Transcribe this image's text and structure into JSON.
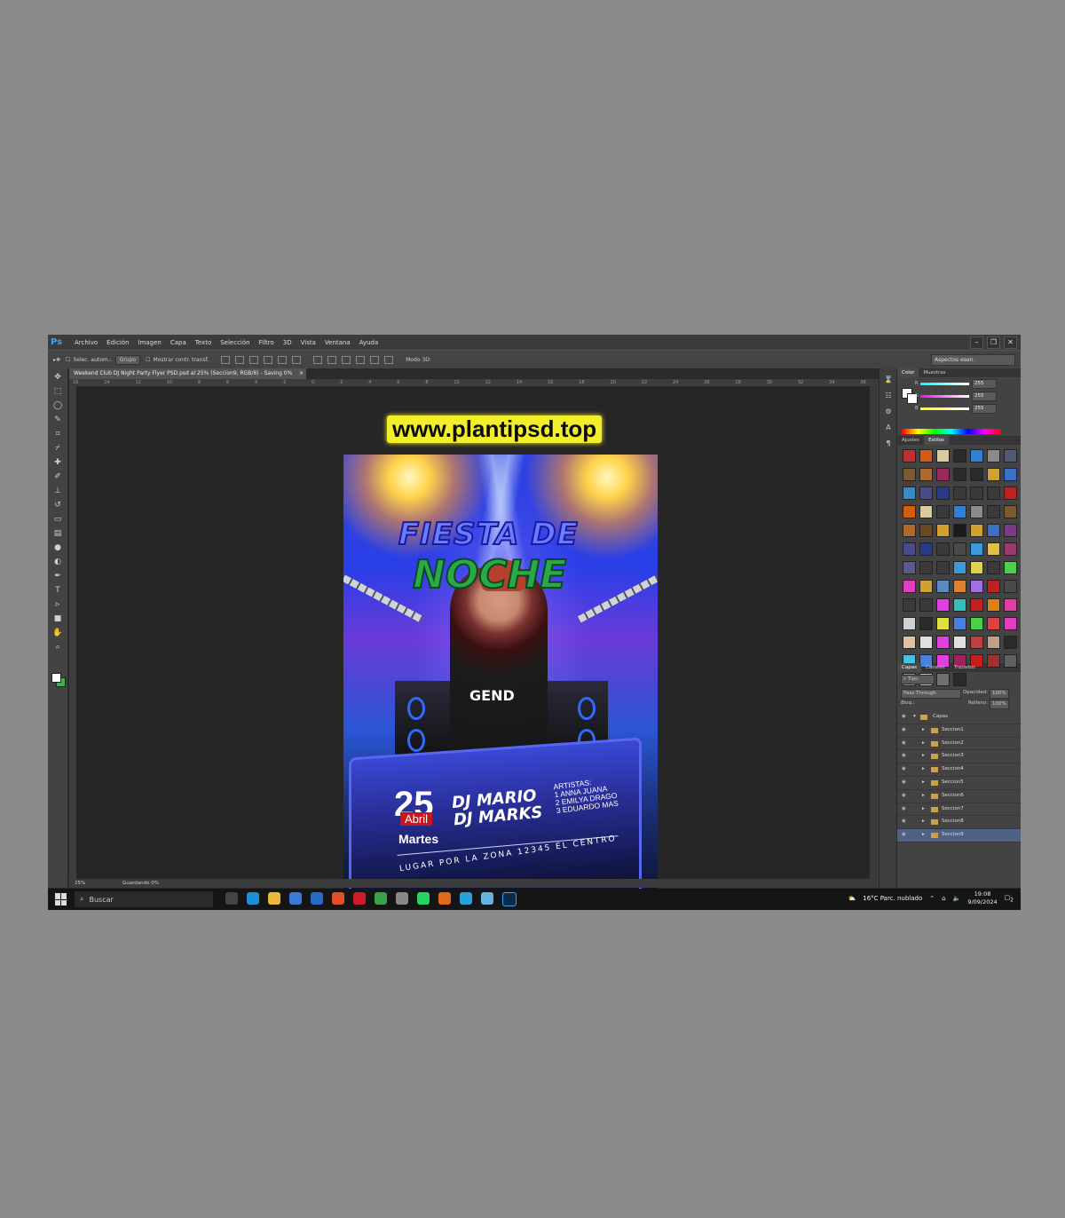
{
  "menu": {
    "logo": "Ps",
    "items": [
      "Archivo",
      "Edición",
      "Imagen",
      "Capa",
      "Texto",
      "Selección",
      "Filtro",
      "3D",
      "Vista",
      "Ventana",
      "Ayuda"
    ]
  },
  "options": {
    "auto_select": "Selec. autom.:",
    "group": "Grupo",
    "show_transform": "Mostrar contr. transf.",
    "mode3d": "Modo 3D:",
    "workspace": "Aspectos esen."
  },
  "document": {
    "tab_title": "Weekend Club DJ Night Party Flyer PSD.psd al 25% (Seccion9, RGB/8) - Saving 0%",
    "zoom": "25%",
    "status": "Guardando 0%"
  },
  "ruler_ticks": [
    "16",
    "14",
    "12",
    "10",
    "8",
    "6",
    "4",
    "2",
    "0",
    "2",
    "4",
    "6",
    "8",
    "10",
    "12",
    "14",
    "16",
    "18",
    "20",
    "22",
    "24",
    "26",
    "28",
    "30",
    "32",
    "34",
    "36"
  ],
  "watermark": "www.plantipsd.top",
  "flyer": {
    "title_line1": "FIESTA DE",
    "title_line2": "NOCHE",
    "shirt": "GEND",
    "day": "25",
    "month": "Abril",
    "weekday": "Martes",
    "dj1": "DJ MARIO",
    "dj2": "DJ MARKS",
    "artists": [
      "ARTISTAS:",
      "1 ANNA JUANA",
      "2 EMILYA DRAGO",
      "3 EDUARDO MAS"
    ],
    "venue": "LUGAR POR LA ZONA 12345 EL CENTRO"
  },
  "panels": {
    "color_tabs": [
      "Color",
      "Muestras"
    ],
    "rgb": [
      {
        "label": "R",
        "value": "255"
      },
      {
        "label": "G",
        "value": "255"
      },
      {
        "label": "B",
        "value": "255"
      }
    ],
    "style_tabs": [
      "Ajustes",
      "Estilos"
    ],
    "layer_tabs": [
      "Capas",
      "Canales",
      "Trazados"
    ],
    "filter": "Tipo",
    "blend": "Pass Through",
    "opacity_label": "Opacidad:",
    "opacity": "100%",
    "lock_label": "Bloq.:",
    "fill_label": "Relleno:",
    "fill": "100%",
    "group_name": "Capas",
    "layers": [
      "Seccion1",
      "Seccion2",
      "Seccion3",
      "Seccion4",
      "Seccion5",
      "Seccion6",
      "Seccion7",
      "Seccion8",
      "Seccion9"
    ],
    "selected_layer": "Seccion9"
  },
  "style_colors": [
    "#c03030",
    "#d65a10",
    "#d8cba0",
    "#2a2a2a",
    "#2f7fd6",
    "#8a8a8a",
    "#505a70",
    "#7a5a30",
    "#ad6a2a",
    "#9a2a5a",
    "#2a2a2a",
    "#2a2a2a",
    "#d0a030",
    "#3a70c8",
    "#3a8ac8",
    "#4a4a8a",
    "#2a3a8a",
    "#3a3a3a",
    "#3a3a3a",
    "#3a3a3a",
    "#c02020",
    "#d06010",
    "#d8cba0",
    "#3a3a3a",
    "#2f7fd6",
    "#8a8a8a",
    "#3a3a3a",
    "#7a5a30",
    "#ad6a2a",
    "#6a4a20",
    "#d0a030",
    "#1a1a1a",
    "#d0a030",
    "#3a70c8",
    "#7a3a8a",
    "#4a4a8a",
    "#2a3a8a",
    "#3a3a3a",
    "#4a4a4a",
    "#3a9ad6",
    "#e0c040",
    "#9a3a6a",
    "#5a5a8a",
    "#3a3a3a",
    "#3a3a3a",
    "#3a9ad6",
    "#e0d050",
    "#3a3a3a",
    "#4ad04a",
    "#e040c0",
    "#d0a030",
    "#5a8ac0",
    "#e08030",
    "#a070e0",
    "#c02020",
    "#4a4a4a",
    "#3a3a3a",
    "#3a3a3a",
    "#e040e0",
    "#30c0c0",
    "#c02020",
    "#e08010",
    "#e040a0",
    "#d0d0d0",
    "#2a2a2a",
    "#e0e040",
    "#4a80e0",
    "#4ad04a",
    "#e04040",
    "#e040c0",
    "#e0c0a0",
    "#e0e0e0",
    "#e040e0",
    "#e0e0e0",
    "#c04040",
    "#c0a080",
    "#2a2a2a",
    "#4ac0e0",
    "#4a80e0",
    "#e040e0",
    "#a02060",
    "#c02020",
    "#a03030",
    "#606060",
    "#909090",
    "#c0c0c0",
    "#707070",
    "#2a2a2a"
  ],
  "taskbar": {
    "search": "Buscar",
    "weather": "16°C  Parc. nublado",
    "time": "19:08",
    "date": "9/09/2024",
    "notifications": "2"
  }
}
